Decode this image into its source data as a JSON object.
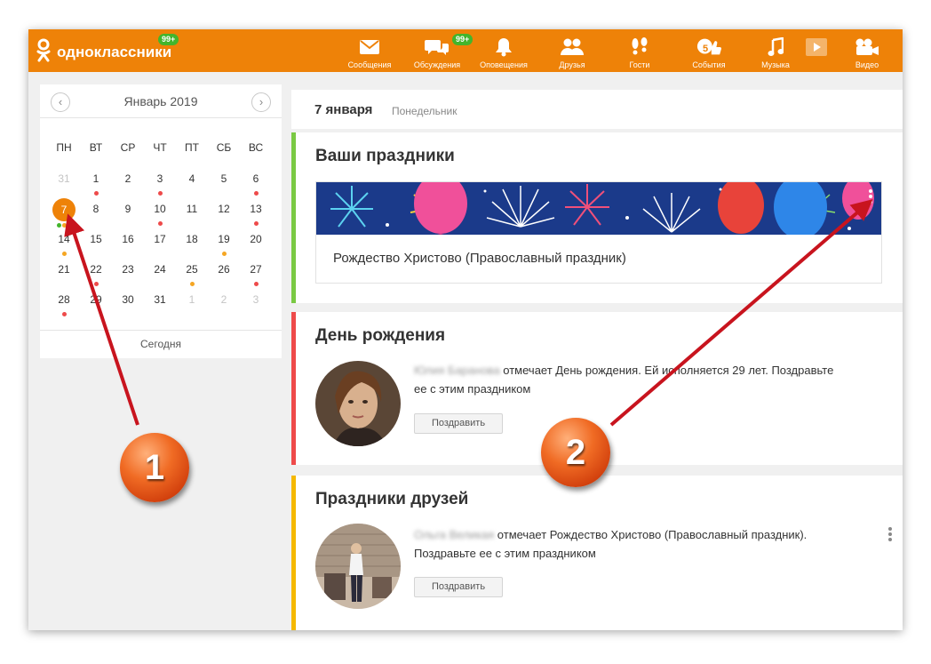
{
  "app": {
    "brand_name": "одноклассники",
    "brand_badge": "99+",
    "brand_color": "#ee8208"
  },
  "nav": {
    "items": [
      {
        "label": "Сообщения",
        "icon": "envelope-icon"
      },
      {
        "label": "Обсуждения",
        "icon": "chat-bubbles-icon",
        "badge": "99+"
      },
      {
        "label": "Оповещения",
        "icon": "bell-icon"
      },
      {
        "label": "Друзья",
        "icon": "friends-icon"
      },
      {
        "label": "Гости",
        "icon": "footprints-icon"
      },
      {
        "label": "События",
        "icon": "events-icon",
        "badge": "5"
      },
      {
        "label": "Музыка",
        "icon": "music-note-icon"
      },
      {
        "label": "",
        "icon": "video-play-icon"
      },
      {
        "label": "Видео",
        "icon": "video-camera-icon"
      }
    ]
  },
  "calendar": {
    "title": "Январь 2019",
    "prev_label": "‹",
    "next_label": "›",
    "weekdays": [
      "ПН",
      "ВТ",
      "СР",
      "ЧТ",
      "ПТ",
      "СБ",
      "ВС"
    ],
    "today_label": "Сегодня",
    "weeks": [
      [
        "31",
        "1",
        "2",
        "3",
        "4",
        "5",
        "6"
      ],
      [
        "7",
        "8",
        "9",
        "10",
        "11",
        "12",
        "13"
      ],
      [
        "14",
        "15",
        "16",
        "17",
        "18",
        "19",
        "20"
      ],
      [
        "21",
        "22",
        "23",
        "24",
        "25",
        "26",
        "27"
      ],
      [
        "28",
        "29",
        "30",
        "31",
        "1",
        "2",
        "3"
      ]
    ],
    "selected_day": "7",
    "event_colors": {
      "red": "#ee4a4a",
      "orange": "#f5a623",
      "green": "#43b52c"
    }
  },
  "main": {
    "date": "7 января",
    "weekday": "Понедельник",
    "holidays": {
      "title": "Ваши праздники",
      "holiday_name": "Рождество Христово (Православный праздник)",
      "accent": "#7ac943"
    },
    "birthday": {
      "title": "День рождения",
      "person_name": "Юлия Баранова",
      "text": " отмечает День рождения. Ей исполняется 29 лет. Поздравьте",
      "text2": "ее с этим праздником",
      "button": "Поздравить",
      "accent": "#ee4a4a"
    },
    "friends": {
      "title": "Праздники друзей",
      "person_name": "Ольга Великая",
      "text": " отмечает Рождество Христово (Православный праздник).",
      "text2": "Поздравьте ее с этим праздником",
      "button": "Поздравить",
      "accent": "#f5b800"
    }
  },
  "annotations": {
    "marker1": "1",
    "marker2": "2",
    "arrow_color": "#c8141e"
  }
}
